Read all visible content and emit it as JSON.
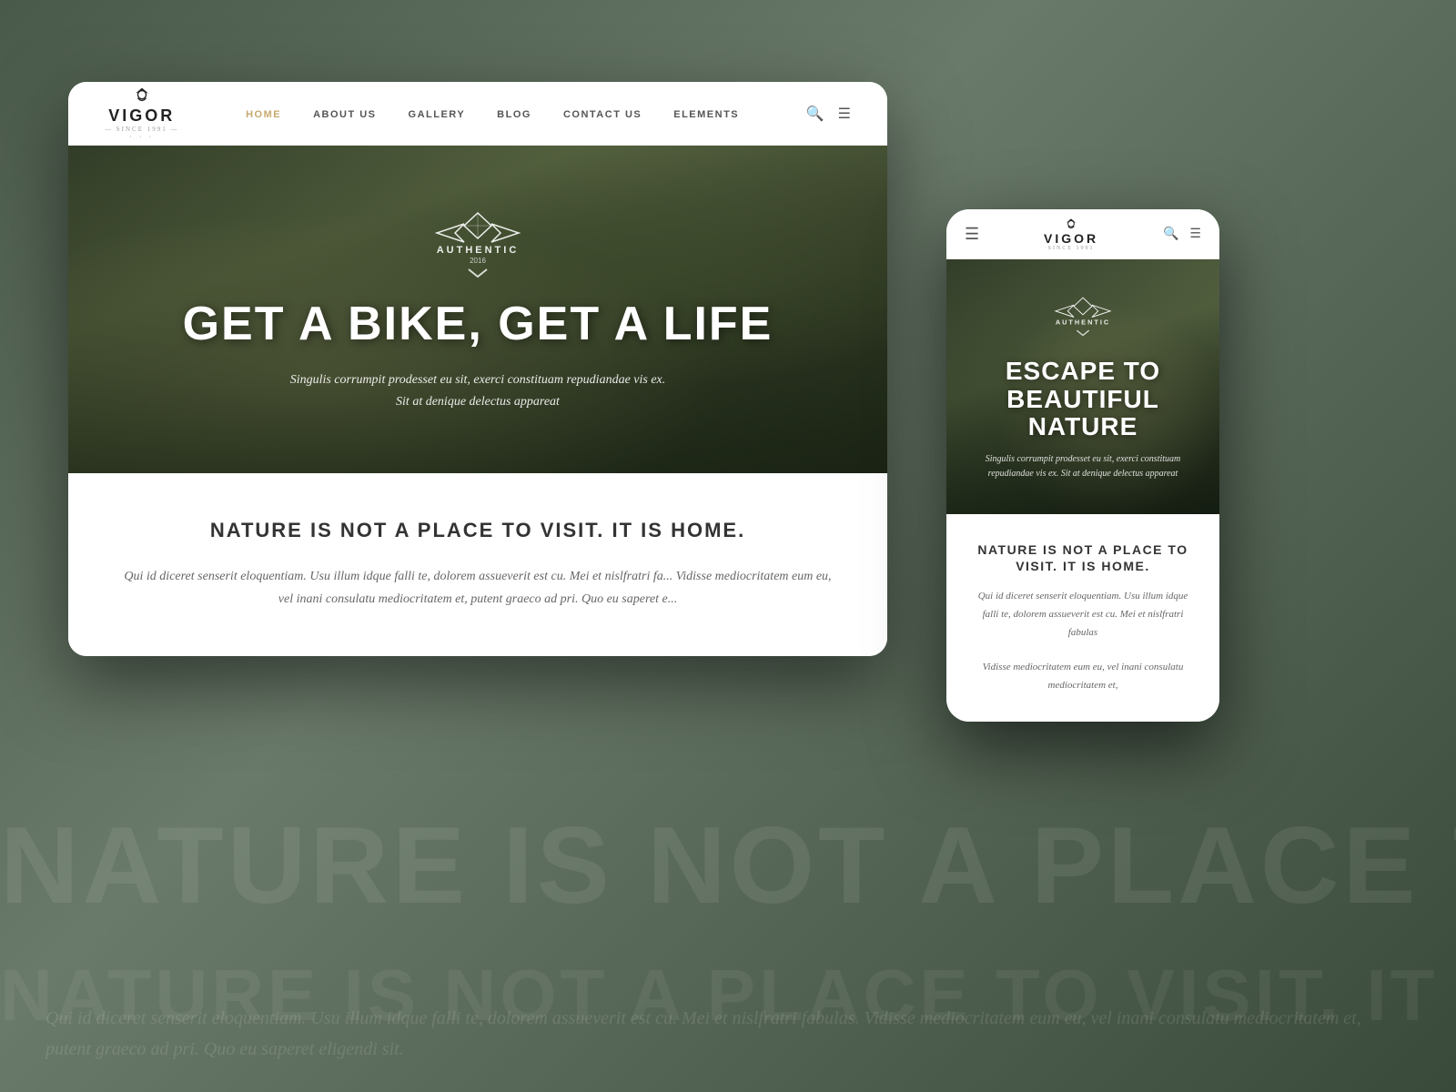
{
  "background": {
    "watermark_text": "NATURE IS NOT A PLACE TO VISIT. IT IS HOME.",
    "watermark_text2": "NATURE IS NOT A PLACE TO VISIT. IT IS HOME.",
    "bg_paragraph": "Qui id diceret senserit eloquentiam. Usu illum idque falli te, dolorem assueverit est cu. Mei et nislfratri fabulas. Vidisse mediocritatem eum eu, vel inani consulatu mediocritatem et, putent graeco ad pri. Quo eu saperet eligendi sit."
  },
  "desktop": {
    "nav": {
      "logo_title": "VIGOR",
      "logo_since": "— SINCE 1991 —",
      "logo_dots": "· · ·",
      "links": [
        {
          "label": "HOME",
          "active": true
        },
        {
          "label": "ABOUT US",
          "active": false
        },
        {
          "label": "GALLERY",
          "active": false
        },
        {
          "label": "BLOG",
          "active": false
        },
        {
          "label": "CONTACT US",
          "active": false
        },
        {
          "label": "ELEMENTS",
          "active": false
        }
      ]
    },
    "hero": {
      "badge_text": "AUTHENTIC",
      "badge_year": "2016",
      "title": "GET A BIKE, GET A LIFE",
      "subtitle_line1": "Singulis corrumpit prodesset eu sit, exerci constituam repudiandae vis ex.",
      "subtitle_line2": "Sit at denique delectus appareat"
    },
    "content": {
      "title": "NATURE IS NOT A PLACE TO VISIT. IT IS HOME.",
      "text": "Qui id diceret senserit eloquentiam. Usu illum idque falli te, dolorem assueverit est cu. Mei et nislfratri fa... Vidisse mediocritatem eum eu, vel inani consulatu mediocritatem et, putent graeco ad pri. Quo eu saperet e..."
    }
  },
  "mobile": {
    "nav": {
      "logo_title": "VIGOR",
      "logo_since": "SINCE 1991"
    },
    "hero": {
      "badge_text": "AUTHENTIC",
      "title": "ESCAPE TO BEAUTIFUL NATURE",
      "subtitle": "Singulis corrumpit prodesset eu sit, exerci constituam repudiandae vis ex. Sit at denique delectus appareat"
    },
    "content": {
      "title": "NATURE IS NOT A PLACE TO VISIT. IT IS HOME.",
      "text_p1": "Qui id diceret senserit eloquentiam. Usu illum idque falli te, dolorem assueverit est cu. Mei et nislfratri fabulas",
      "text_p2": "Vidisse mediocritatem eum eu, vel inani consulatu mediocritatem et,"
    }
  },
  "colors": {
    "accent": "#c8a96e",
    "dark": "#222222",
    "text_muted": "#666666",
    "white": "#ffffff"
  }
}
